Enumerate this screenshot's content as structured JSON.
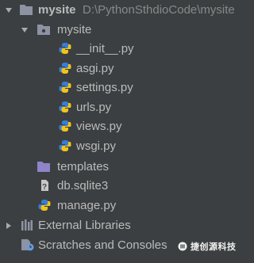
{
  "root": {
    "name": "mysite",
    "path": "D:\\PythonSthdioCode\\mysite"
  },
  "package": {
    "name": "mysite",
    "files": [
      "__init__.py",
      "asgi.py",
      "settings.py",
      "urls.py",
      "views.py",
      "wsgi.py"
    ]
  },
  "templates": {
    "name": "templates"
  },
  "db": {
    "name": "db.sqlite3"
  },
  "manage": {
    "name": "manage.py"
  },
  "external": {
    "name": "External Libraries"
  },
  "scratches": {
    "name": "Scratches and Consoles"
  },
  "watermark": {
    "text": "捷创源科技"
  },
  "icons": {
    "folder": "folder-icon",
    "package": "package-folder-icon",
    "python": "python-file-icon",
    "database": "database-file-icon",
    "libraries": "library-icon",
    "scratches": "scratches-icon"
  },
  "colors": {
    "background": "#3c3f41",
    "text": "#bbbbbb",
    "path_text": "#888888",
    "folder": "#8d93a3",
    "templates_folder": "#8f83c9",
    "python_blue": "#3a7bd5",
    "python_yellow": "#f0c419"
  }
}
